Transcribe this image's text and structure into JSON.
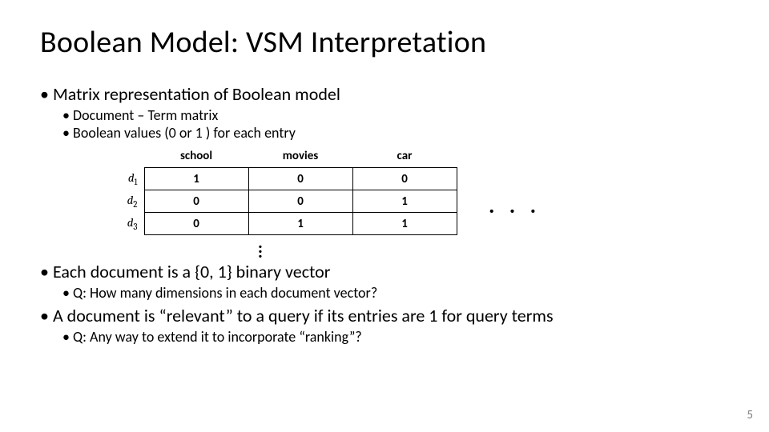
{
  "title": "Boolean Model: VSM Interpretation",
  "bullets": {
    "b1": "Matrix representation of Boolean model",
    "b1_sub1": "Document – Term matrix",
    "b1_sub2": "Boolean values (0 or 1 ) for each entry",
    "b2": "Each document is a {0, 1} binary vector",
    "b2_sub1": "Q: How many dimensions in each document vector?",
    "b3": "A document is “relevant” to a query if its entries are 1 for query terms",
    "b3_sub1": "Q: Any way to extend it to incorporate “ranking”?"
  },
  "matrix": {
    "headers": {
      "h1": "school",
      "h2": "movies",
      "h3": "car"
    },
    "rows": {
      "r1": {
        "label_base": "d",
        "label_sub": "1",
        "c1": "1",
        "c2": "0",
        "c3": "0"
      },
      "r2": {
        "label_base": "d",
        "label_sub": "2",
        "c1": "0",
        "c2": "0",
        "c3": "1"
      },
      "r3": {
        "label_base": "d",
        "label_sub": "3",
        "c1": "0",
        "c2": "1",
        "c3": "1"
      }
    }
  },
  "ellipsis_h": ". . .",
  "page_number": "5",
  "chart_data": {
    "type": "table",
    "title": "Document–Term Boolean matrix",
    "columns": [
      "school",
      "movies",
      "car"
    ],
    "rows": [
      {
        "name": "d1",
        "values": [
          1,
          0,
          0
        ]
      },
      {
        "name": "d2",
        "values": [
          0,
          0,
          1
        ]
      },
      {
        "name": "d3",
        "values": [
          0,
          1,
          1
        ]
      }
    ]
  }
}
